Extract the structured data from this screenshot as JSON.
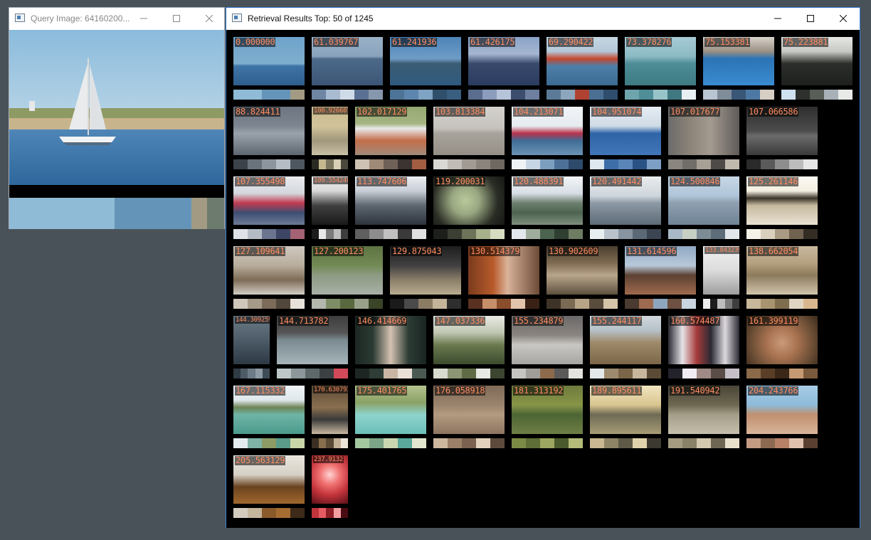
{
  "query_window": {
    "title": "Query Image: 64160200...",
    "palette": [
      "#8fbbd6",
      "#8fbbd6",
      "#8fbbd6",
      "#6495b8",
      "#6495b8",
      "#a39a84",
      "#6d7a6e"
    ]
  },
  "results_window": {
    "title": "Retrieval Results Top: 50 of 1245"
  },
  "results": [
    {
      "score": "0.000000",
      "bg": "linear-gradient(#6fa3cb 0%,#7faecd 55%,#3f74a7 60%,#2e5f8d 100%)",
      "pal": [
        "#8fbbd6",
        "#8fbbd6",
        "#6495b8",
        "#6495b8",
        "#a39a84"
      ]
    },
    {
      "score": "61.039767",
      "bg": "linear-gradient(#9ab1c7 0%,#8aa3bd 40%,#4d6a8a 45%,#3c5575 100%)",
      "pal": [
        "#6f86a3",
        "#a8bbd1",
        "#cfdbe8",
        "#5b7193",
        "#8797ad"
      ]
    },
    {
      "score": "61.241936",
      "bg": "linear-gradient(#4e84b7 0%,#6f9cc6 45%,#3b5c72 55%,#2f5a80 100%)",
      "pal": [
        "#4d7496",
        "#5c86ad",
        "#7fa3c2",
        "#2f4f6b",
        "#3a5e80"
      ]
    },
    {
      "score": "61.426175",
      "bg": "linear-gradient(#8aa2c6 0%,#a6b6d2 35%,#39496b 55%,#2c3c61 100%)",
      "pal": [
        "#5a6d8f",
        "#8b9cbc",
        "#b6c4da",
        "#3d4d6e",
        "#6e7f9f"
      ]
    },
    {
      "score": "69.290422",
      "bg": "linear-gradient(#c6d6e3 0%,#b3c8d8 30%,#c5472e 45%,#4c7fa8 60%,#3c6a92 100%)",
      "pal": [
        "#5b7a98",
        "#8da6bd",
        "#b04232",
        "#4a6f92",
        "#2f4d6c"
      ]
    },
    {
      "score": "73.378276",
      "bg": "linear-gradient(#a7cbd5 0%,#8cbac4 40%,#4d8d96 55%,#3e7a82 100%)",
      "pal": [
        "#6ea5ad",
        "#4f8e96",
        "#98c4c9",
        "#3f7880",
        "#e9f0f2"
      ]
    },
    {
      "score": "75.153381",
      "bg": "linear-gradient(#d7d3cc 0%,#9a8f83 30%,#2b74b5 45%,#3a8bd1 100%)",
      "pal": [
        "#b9c5d0",
        "#7f8c99",
        "#3a5677",
        "#4d78a3",
        "#d8cfc4"
      ]
    },
    {
      "score": "75.223881",
      "bg": "linear-gradient(#e6e8e4 0%,#c7c9c4 30%,#2b2e2a 55%,#1d201c 100%)",
      "pal": [
        "#cfe0ee",
        "#2d302c",
        "#585d56",
        "#a8b1b8",
        "#e7eae6"
      ]
    },
    {
      "score": "88.824411",
      "bg": "linear-gradient(#6c7580 0%,#7d8690 40%,#9aa2ab 55%,#5d6670 100%)",
      "pal": [
        "#3b424a",
        "#6a737c",
        "#8c959e",
        "#b5bcc3",
        "#4e565f"
      ]
    },
    {
      "score": "100.926601",
      "small": true,
      "bg": "linear-gradient(#c8b98f 0%,#d2c39a 40%,#a1977c 70%,#c9c1a6 100%)",
      "pal": [
        "#2a2922",
        "#c6b88e",
        "#7c7560",
        "#d7cfb6",
        "#4a473c"
      ]
    },
    {
      "score": "102.017129",
      "bg": "linear-gradient(#96a872 0%,#a5b583 35%,#e8eaec 45%,#c46d4a 70%,#a08b7b 100%)",
      "pal": [
        "#cdc2b4",
        "#9f8977",
        "#6f6157",
        "#3b3330",
        "#a35d41"
      ]
    },
    {
      "score": "103.813384",
      "bg": "linear-gradient(#d4d2ce 0%,#c5c2bd 45%,#a8a39c 55%,#958f87 100%)",
      "pal": [
        "#dad8d4",
        "#c1bcb5",
        "#a19b93",
        "#8a847c",
        "#6e6860"
      ]
    },
    {
      "score": "104.213071",
      "bg": "linear-gradient(#f1f4f7 0%,#e6ebf0 40%,#b8324a 55%,#3f6c95 70%,#6c93b6 100%)",
      "pal": [
        "#eef2f5",
        "#c7d6e4",
        "#7d9fbf",
        "#4c7097",
        "#2d4a6a"
      ]
    },
    {
      "score": "104.951074",
      "bg": "linear-gradient(#e6edf4 0%,#cfdbe6 40%,#2f64a7 55%,#4176b9 100%)",
      "pal": [
        "#dfe7ef",
        "#3d6ea8",
        "#5a85b8",
        "#2b5284",
        "#7d9fc6"
      ]
    },
    {
      "score": "107.017677",
      "bg": "linear-gradient(90deg,#6b6b6b 0%,#8b8378 30%,#a39a90 60%,#5e5a57 100%)",
      "pal": [
        "#8a857e",
        "#716d68",
        "#a7a096",
        "#4d4a47",
        "#c0b9ae"
      ]
    },
    {
      "score": "107.066586",
      "bg": "linear-gradient(#2e2e2e 0%,#4c4c4c 50%,#6b6b6b 60%,#3a3a3a 100%)",
      "pal": [
        "#2a2a2a",
        "#5a5a5a",
        "#8d8d8d",
        "#bcbcbc",
        "#e6e6e6"
      ]
    },
    {
      "score": "107.355498",
      "bg": "linear-gradient(#e9ebee 0%,#d4d8de 35%,#c23a51 55%,#3e4f72 75%,#6c7a96 100%)",
      "pal": [
        "#dfe2e7",
        "#b6bcc6",
        "#6b7590",
        "#3d4664",
        "#a46274"
      ]
    },
    {
      "score": "109.554246",
      "small": true,
      "bg": "linear-gradient(#f0f0f0 0%,#d8d8d8 30%,#404040 60%,#1a1a1a 100%)",
      "pal": [
        "#1c1c1c",
        "#e8e8e8",
        "#7a7a7a",
        "#bdbdbd",
        "#3e3e3e"
      ]
    },
    {
      "score": "113.747606",
      "bg": "linear-gradient(#ebeef2 0%,#c8ced6 30%,#5e6670 60%,#2d333b 100%)",
      "pal": [
        "#5f5f5f",
        "#8d8d8d",
        "#c0c0c0",
        "#3a3a3a",
        "#e0e0e0"
      ]
    },
    {
      "score": "119.200031",
      "bg": "radial-gradient(circle at 45% 50%,#b9c99a 0%,#9aa882 30%,#2a2d25 70%,#151714 100%)",
      "pal": [
        "#1d1f1a",
        "#3b3f33",
        "#6c7358",
        "#a6b08a",
        "#d5dcc0"
      ]
    },
    {
      "score": "120.488391",
      "bg": "linear-gradient(#f3f5f7 0%,#d7dee5 35%,#6c7f6e 55%,#4d6450 75%,#7f8e7d 100%)",
      "pal": [
        "#e3e8ec",
        "#9fae9c",
        "#4c6350",
        "#2f4032",
        "#6e7c62"
      ]
    },
    {
      "score": "120.491442",
      "bg": "linear-gradient(#e8ecef 0%,#cfd6dc 40%,#8d9aa5 55%,#5d6b78 100%)",
      "pal": [
        "#e8edf0",
        "#b9c2ca",
        "#8894a0",
        "#5b6875",
        "#3b4652"
      ]
    },
    {
      "score": "124.500846",
      "bg": "linear-gradient(#c7d7e6 0%,#b0c5d9 40%,#8e9fae 55%,#6f8396 100%)",
      "pal": [
        "#a9b8c6",
        "#c7cec4",
        "#7d8b94",
        "#5c6c78",
        "#e0e6ea"
      ]
    },
    {
      "score": "125.261146",
      "bg": "linear-gradient(#fbf9f2 0%,#f3efe1 30%,#3b3329 45%,#c6b9a0 60%,#e9e2d2 100%)",
      "pal": [
        "#f4f1e8",
        "#d8cfbd",
        "#a99a83",
        "#6f624f",
        "#342d24"
      ]
    },
    {
      "score": "127.109641",
      "bg": "linear-gradient(#cfc9bf 0%,#b8ad9c 40%,#7e6b56 70%,#d2cdc5 100%)",
      "pal": [
        "#cfc7bb",
        "#a69a88",
        "#7b6b58",
        "#52473b",
        "#e6e1d9"
      ]
    },
    {
      "score": "127.200123",
      "bg": "linear-gradient(#5d7342 0%,#728a54 40%,#8c9a83 60%,#a9b0a6 100%)",
      "pal": [
        "#b3b7ae",
        "#7f8d66",
        "#59683f",
        "#98a089",
        "#3a4427"
      ]
    },
    {
      "score": "129.875043",
      "bg": "linear-gradient(#1e1e1e 0%,#404040 40%,#8c7f6a 70%,#b9ab90 100%)",
      "pal": [
        "#1a1a1a",
        "#4a4a4a",
        "#8b7c64",
        "#c4b59a",
        "#2e2e2e"
      ]
    },
    {
      "score": "130.514379",
      "bg": "linear-gradient(90deg,#7a3b1e 0%,#b85a2a 35%,#d9b39a 55%,#6b4a36 100%)",
      "pal": [
        "#5a3120",
        "#c78e6a",
        "#8b4e2d",
        "#e2c3ab",
        "#3a2116"
      ]
    },
    {
      "score": "130.902609",
      "bg": "linear-gradient(#4b3f30 0%,#7e6b52 35%,#b8a58a 60%,#5e503f 100%)",
      "pal": [
        "#3d3327",
        "#7b6a53",
        "#b8a487",
        "#5a4c3c",
        "#d5c4a8"
      ]
    },
    {
      "score": "131.614596",
      "bg": "linear-gradient(#8fa8c3 0%,#b9c9da 40%,#5c4133 60%,#a06a4d 100%)",
      "pal": [
        "#4b3a30",
        "#9d6b4f",
        "#8fa6bf",
        "#6e5142",
        "#c9d4df"
      ]
    },
    {
      "score": "133.843239",
      "small": true,
      "bg": "linear-gradient(#f1f1f1 0%,#dcdcdc 50%,#9d9d9d 100%)",
      "pal": [
        "#efefef",
        "#1d1d1d",
        "#bdbdbd",
        "#7a7a7a",
        "#3e3e3e"
      ]
    },
    {
      "score": "138.662054",
      "bg": "linear-gradient(#c8b99f 0%,#b5a17f 35%,#8c7a5c 60%,#d2c5ad 100%)",
      "pal": [
        "#c7b79b",
        "#a8946f",
        "#7f6d50",
        "#e0d5c2",
        "#d9b78e"
      ]
    },
    {
      "score": "144.309259",
      "small": true,
      "bg": "linear-gradient(#6b7b86 0%,#4d5c68 50%,#2d3a44 100%)",
      "pal": [
        "#2f3b45",
        "#4d5b66",
        "#6c7b86",
        "#8d9ba5",
        "#3e4c57"
      ]
    },
    {
      "score": "144.713782",
      "bg": "linear-gradient(#3d3d3d 0%,#555 35%,#7a8a90 50%,#a7b5ba 100%)",
      "pal": [
        "#bfc6c9",
        "#8d979b",
        "#5e676a",
        "#3b4143",
        "#d24a5a"
      ]
    },
    {
      "score": "146.414669",
      "bg": "linear-gradient(90deg,#1d2723 0%,#2a3a33 25%,#d5c2b1 50%,#2c3c35 75%,#1a2420 100%)",
      "pal": [
        "#1d2622",
        "#2e3e37",
        "#c9b6a4",
        "#e9e1d8",
        "#4a5a52"
      ]
    },
    {
      "score": "147.037336",
      "bg": "linear-gradient(#e9ebe5 0%,#bfc6b1 35%,#6b7a4f 60%,#3b4a2e 100%)",
      "pal": [
        "#d7dbd0",
        "#8c9675",
        "#5f6b45",
        "#e6e8e3",
        "#3b4530"
      ]
    },
    {
      "score": "155.234879",
      "bg": "linear-gradient(#6a6868 0%,#8a8580 40%,#c9c7c4 60%,#a7a5a2 100%)",
      "pal": [
        "#c7c5c2",
        "#a19e9a",
        "#8e6a4c",
        "#5c5a58",
        "#e4e2df"
      ]
    },
    {
      "score": "155.244117",
      "bg": "linear-gradient(#d1d8dd 0%,#b6c1c8 30%,#9f8a6a 55%,#7b6648 100%)",
      "pal": [
        "#e4e7ea",
        "#9d8a6e",
        "#7a6549",
        "#c7b69c",
        "#5a4a36"
      ]
    },
    {
      "score": "160.574487",
      "bg": "linear-gradient(90deg,#2b2b33 0%,#e6e2e8 20%,#a63b3b 40%,#2a2a33 60%,#dcd8de 80%,#2b2b33 100%)",
      "pal": [
        "#23232b",
        "#f0eaf2",
        "#9f8a86",
        "#5a4c46",
        "#c7c0c9"
      ]
    },
    {
      "score": "161.399119",
      "bg": "radial-gradient(circle at 50% 55%,#c99a7a 0%,#a87250 35%,#6b4e35 70%,#3a2a1c 100%)",
      "pal": [
        "#8b6a4a",
        "#5a3e27",
        "#3b2717",
        "#c59a73",
        "#7a5a3c"
      ]
    },
    {
      "score": "167.115332",
      "bg": "linear-gradient(#eef3f6 0%,#dfe8ec 30%,#6d8456 45%,#6fb4a5 60%,#4a9b8c 100%)",
      "pal": [
        "#e5ecef",
        "#7eb3a5",
        "#8c9c64",
        "#5a9b8a",
        "#c9d6a8"
      ]
    },
    {
      "score": "170.630793",
      "small": true,
      "bg": "linear-gradient(#5a4a35 0%,#8a6f4f 45%,#3a3a3a 70%,#c8b8a0 100%)",
      "pal": [
        "#3a2f22",
        "#8a6f4f",
        "#5a4a36",
        "#c2b097",
        "#ece4d8"
      ]
    },
    {
      "score": "175.401765",
      "bg": "linear-gradient(#b5c28f 0%,#8aa265 35%,#8ed3cc 60%,#6cc0b8 100%)",
      "pal": [
        "#a4c7a0",
        "#7da487",
        "#c9d6b0",
        "#5aa79c",
        "#e2e6cf"
      ]
    },
    {
      "score": "176.058918",
      "bg": "linear-gradient(#7f6a58 0%,#9b846d 40%,#b39a80 60%,#8e7560 100%)",
      "pal": [
        "#cdb89e",
        "#9c8067",
        "#7a6150",
        "#e2d1bc",
        "#5e4a3c"
      ]
    },
    {
      "score": "181.313192",
      "bg": "linear-gradient(#6e7a3c 0%,#879548 40%,#4d6534 60%,#6f7f46 100%)",
      "pal": [
        "#7b8a44",
        "#5e6e36",
        "#9da660",
        "#4a5a2c",
        "#b4bb7a"
      ]
    },
    {
      "score": "189.895611",
      "bg": "linear-gradient(#f1e5c0 0%,#d9c590 40%,#6e6a55 60%,#a89c76 100%)",
      "pal": [
        "#c9b891",
        "#8e8466",
        "#5f5a48",
        "#e0d2ab",
        "#3c3a30"
      ]
    },
    {
      "score": "191.540942",
      "bg": "linear-gradient(#4a4538 0%,#6e6752 40%,#a49e88 60%,#c5bfae 100%)",
      "pal": [
        "#a49b80",
        "#8a8268",
        "#d2c9b0",
        "#6e6652",
        "#e8e0cb"
      ]
    },
    {
      "score": "204.243766",
      "bg": "linear-gradient(#a8cde6 0%,#8dbbd9 40%,#c0906f 60%,#d9b59a 100%)",
      "pal": [
        "#c39a82",
        "#8c6a52",
        "#b88066",
        "#e0c2ae",
        "#5a4030"
      ]
    },
    {
      "score": "205.563129",
      "bg": "linear-gradient(#e9e6df 0%,#d6d1c6 40%,#6a4220 65%,#a0682d 100%)",
      "pal": [
        "#d4cdbf",
        "#c4b59c",
        "#8a5a2b",
        "#a66d33",
        "#3e2a18"
      ]
    },
    {
      "score": "237.9132",
      "small": true,
      "bg": "radial-gradient(circle at 50% 40%,#ffd2d2 0%,#f07070 30%,#c3343b 60%,#5a1018 100%)",
      "pal": [
        "#c2343b",
        "#e75c62",
        "#8e1f27",
        "#f4a0a3",
        "#4a0c12"
      ]
    }
  ]
}
